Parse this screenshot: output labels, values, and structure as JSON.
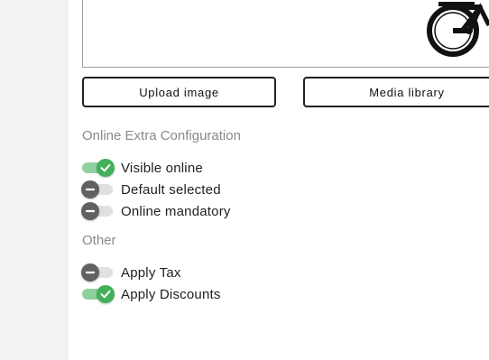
{
  "buttons": {
    "upload_label": "Upload image",
    "media_label": "Media library"
  },
  "online_config": {
    "title": "Online Extra Configuration",
    "toggles": [
      {
        "label": "Visible online",
        "on": true
      },
      {
        "label": "Default selected",
        "on": false
      },
      {
        "label": "Online mandatory",
        "on": false
      }
    ]
  },
  "other": {
    "title": "Other",
    "toggles": [
      {
        "label": "Apply Tax",
        "on": false
      },
      {
        "label": "Apply Discounts",
        "on": true
      }
    ]
  },
  "colors": {
    "toggle_on_knob": "#43b05c",
    "toggle_on_track": "#8fd19e",
    "toggle_off_knob": "#616161",
    "toggle_off_track": "#e0e0e0"
  },
  "icons": {
    "on": "check-icon",
    "off": "minus-icon",
    "image": "bicycle-icon"
  }
}
